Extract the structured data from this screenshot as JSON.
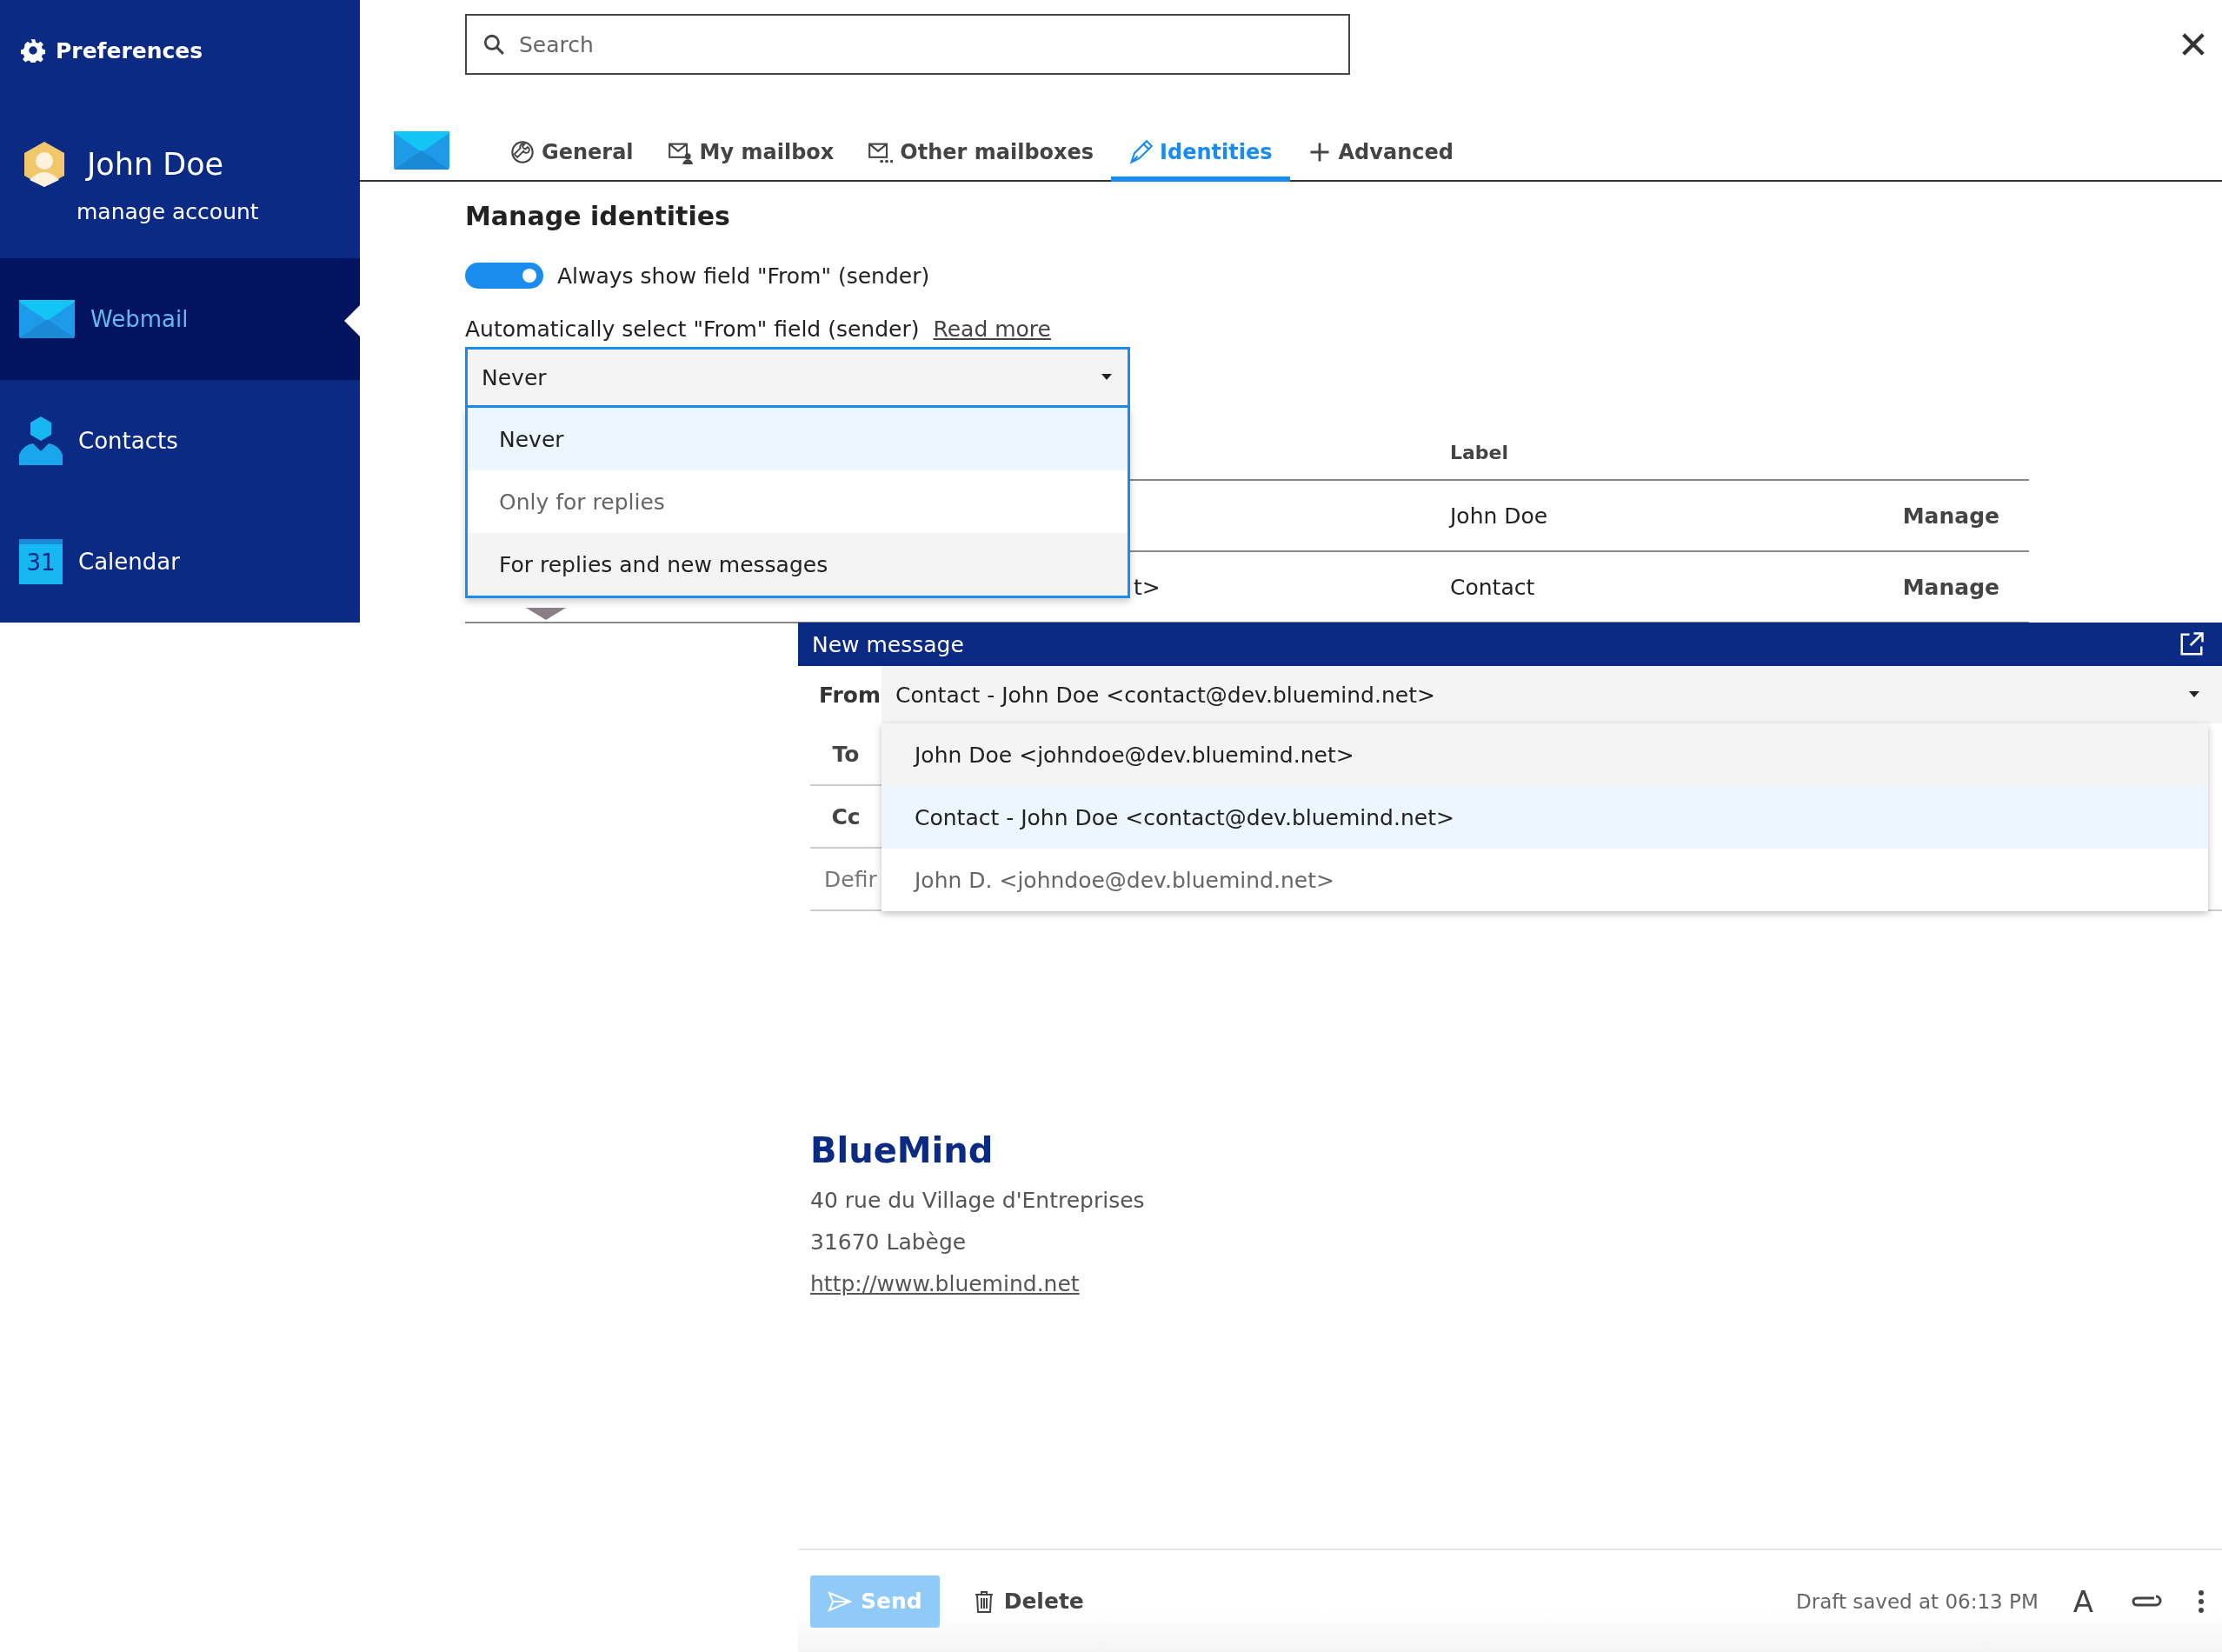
{
  "sidebar": {
    "title": "Preferences",
    "user": {
      "name": "John Doe",
      "link": "manage account"
    },
    "items": [
      {
        "label": "Webmail",
        "kind": "mail",
        "selected": true
      },
      {
        "label": "Contacts",
        "kind": "contacts",
        "selected": false
      },
      {
        "label": "Calendar",
        "kind": "calendar",
        "icon_text": "31",
        "selected": false
      }
    ]
  },
  "search": {
    "placeholder": "Search"
  },
  "tabs": [
    {
      "label": "General",
      "kind": "general",
      "selected": false
    },
    {
      "label": "My mailbox",
      "kind": "mailbox",
      "selected": false
    },
    {
      "label": "Other mailboxes",
      "kind": "others",
      "selected": false
    },
    {
      "label": "Identities",
      "kind": "identities",
      "selected": true
    },
    {
      "label": "Advanced",
      "kind": "advanced",
      "selected": false
    }
  ],
  "section": {
    "title": "Manage identities"
  },
  "always_show_from": {
    "label": "Always show field \"From\" (sender)",
    "on": true
  },
  "auto_select": {
    "label": "Automatically select \"From\" field (sender)",
    "link": "Read more",
    "value": "Never",
    "expanded": true,
    "options": [
      {
        "label": "Never",
        "selected": true,
        "highlighted": false
      },
      {
        "label": "Only for replies",
        "selected": false,
        "highlighted": false
      },
      {
        "label": "For replies and new messages",
        "selected": false,
        "highlighted": true
      }
    ]
  },
  "identities_table": {
    "columns": [
      "Label"
    ],
    "rows": [
      {
        "label": "John Doe",
        "action": "Manage"
      },
      {
        "column_1": "t>",
        "label": "Contact",
        "action": "Manage"
      }
    ]
  },
  "compose": {
    "title": "New message",
    "from": {
      "label": "From",
      "value": "Contact - John Doe <contact@dev.bluemind.net>",
      "expanded": true,
      "options": [
        {
          "label": "John Doe <johndoe@dev.bluemind.net>",
          "selected": false,
          "highlighted": true
        },
        {
          "label": "Contact - John Doe <contact@dev.bluemind.net>",
          "selected": true,
          "highlighted": false
        },
        {
          "label": "John D. <johndoe@dev.bluemind.net>",
          "selected": false,
          "highlighted": false
        }
      ]
    },
    "fields": [
      {
        "label": "To"
      },
      {
        "label": "Cc"
      }
    ],
    "subject": {
      "placeholder": "Defir"
    },
    "signature": {
      "company": "BlueMind",
      "lines": [
        "40 rue du Village d'Entreprises",
        "31670 Labège"
      ],
      "link": "http://www.bluemind.net"
    },
    "footer": {
      "send": {
        "label": "Send",
        "disabled": true
      },
      "delete": "Delete",
      "status": "Draft saved at 06:13 PM",
      "format_icon": "A"
    }
  }
}
